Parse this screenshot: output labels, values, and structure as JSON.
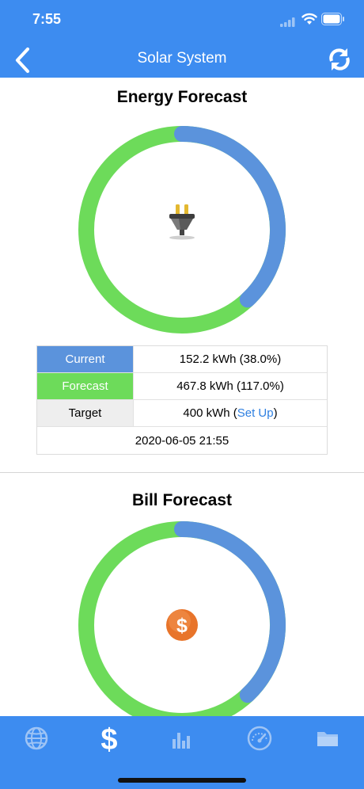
{
  "status": {
    "time": "7:55"
  },
  "nav": {
    "title": "Solar System"
  },
  "energy": {
    "title": "Energy Forecast",
    "current_fraction": 0.38,
    "forecast_fraction": 1.17,
    "rows": {
      "current_label": "Current",
      "current_value": "152.2 kWh (38.0%)",
      "forecast_label": "Forecast",
      "forecast_value": "467.8 kWh (117.0%)",
      "target_label": "Target",
      "target_value_prefix": "400 kWh (",
      "target_link": "Set Up",
      "target_value_suffix": ")",
      "timestamp": "2020-06-05 21:55"
    }
  },
  "bill": {
    "title": "Bill Forecast",
    "currency_symbol": "$"
  },
  "tabs": [
    "globe-icon",
    "dollar-icon",
    "bar-chart-icon",
    "gauge-icon",
    "folder-icon"
  ],
  "colors": {
    "accent": "#3d8cf0",
    "current": "#5b93dc",
    "forecast": "#6ddb5a",
    "link": "#2e7fe0"
  }
}
